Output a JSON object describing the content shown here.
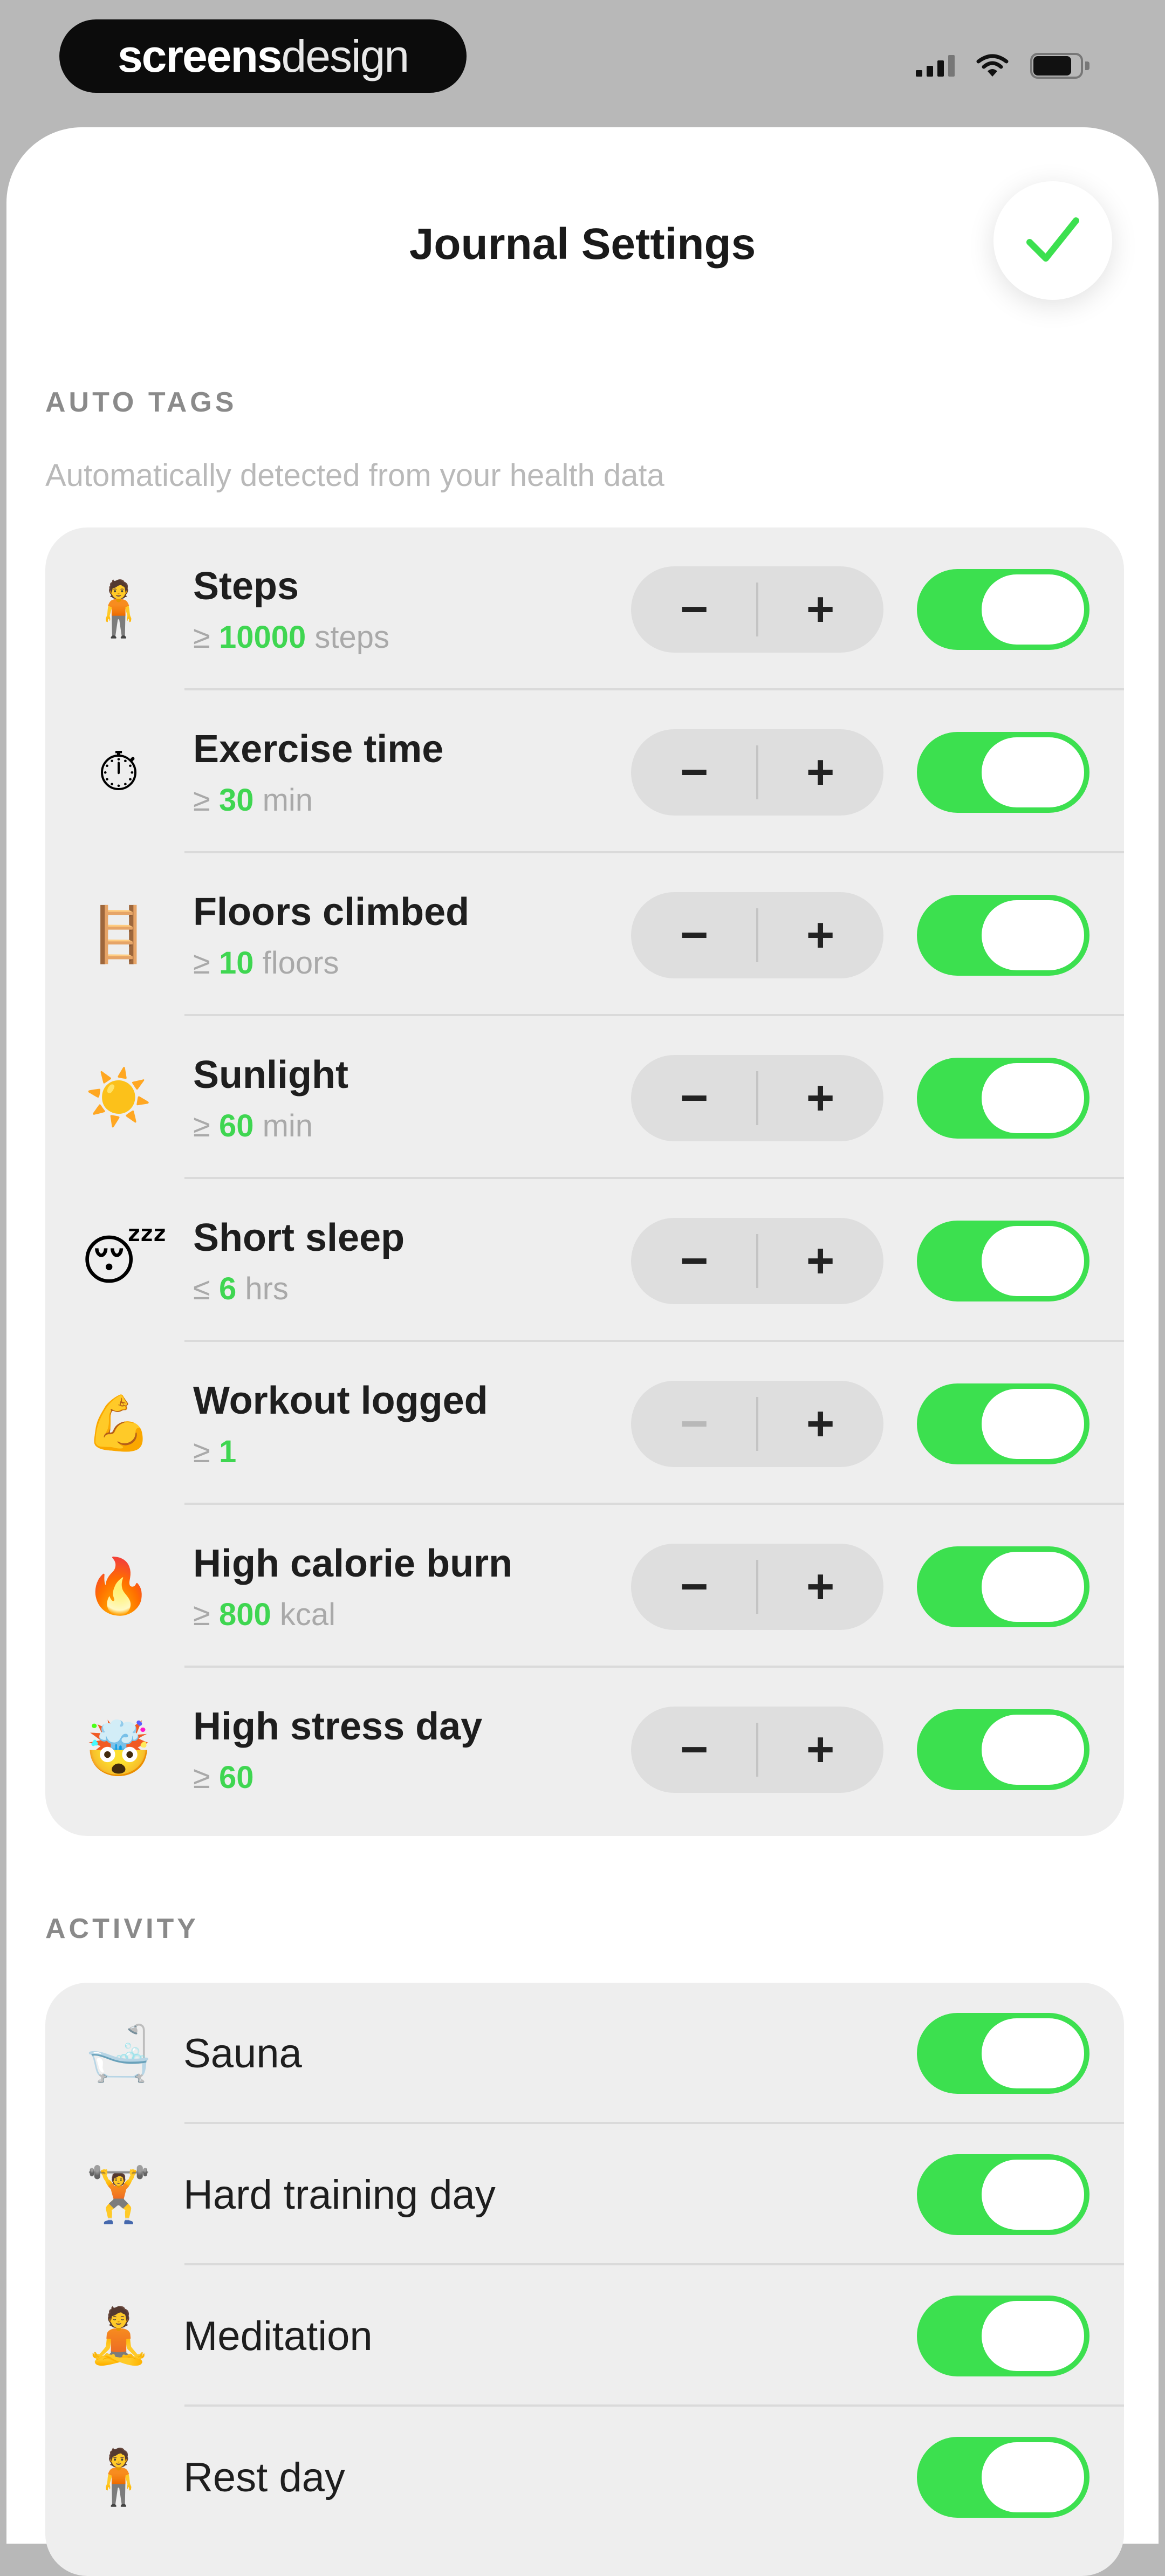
{
  "brand": {
    "bold": "screens",
    "light": "design"
  },
  "header": {
    "title": "Journal Settings"
  },
  "auto_tags": {
    "section_label": "AUTO TAGS",
    "subtitle": "Automatically detected from your health data",
    "minus": "−",
    "plus": "+",
    "items": [
      {
        "icon": "🧍",
        "icon_name": "walking-person-icon",
        "name": "Steps",
        "op": "≥",
        "value": "10000",
        "unit": "steps",
        "enabled": true,
        "minus_disabled": false
      },
      {
        "icon": "⏱",
        "icon_name": "stopwatch-icon",
        "name": "Exercise time",
        "op": "≥",
        "value": "30",
        "unit": "min",
        "enabled": true,
        "minus_disabled": false
      },
      {
        "icon": "🪜",
        "icon_name": "ladder-icon",
        "name": "Floors climbed",
        "op": "≥",
        "value": "10",
        "unit": "floors",
        "enabled": true,
        "minus_disabled": false
      },
      {
        "icon": "☀️",
        "icon_name": "sun-icon",
        "name": "Sunlight",
        "op": "≥",
        "value": "60",
        "unit": "min",
        "enabled": true,
        "minus_disabled": false
      },
      {
        "icon": "😴",
        "icon_name": "sleeping-face-icon",
        "name": "Short sleep",
        "op": "≤",
        "value": "6",
        "unit": "hrs",
        "enabled": true,
        "minus_disabled": false
      },
      {
        "icon": "💪",
        "icon_name": "flexed-biceps-icon",
        "name": "Workout logged",
        "op": "≥",
        "value": "1",
        "unit": "",
        "enabled": true,
        "minus_disabled": true
      },
      {
        "icon": "🔥",
        "icon_name": "fire-icon",
        "name": "High calorie burn",
        "op": "≥",
        "value": "800",
        "unit": "kcal",
        "enabled": true,
        "minus_disabled": false
      },
      {
        "icon": "🤯",
        "icon_name": "exploding-head-icon",
        "name": "High stress day",
        "op": "≥",
        "value": "60",
        "unit": "",
        "enabled": true,
        "minus_disabled": false
      }
    ]
  },
  "activity": {
    "section_label": "ACTIVITY",
    "items": [
      {
        "icon": "🛁",
        "icon_name": "sauna-icon",
        "name": "Sauna",
        "enabled": true
      },
      {
        "icon": "🏋",
        "icon_name": "weightlifter-icon",
        "name": "Hard training day",
        "enabled": true
      },
      {
        "icon": "🧘",
        "icon_name": "meditation-icon",
        "name": "Meditation",
        "enabled": true
      },
      {
        "icon": "🧍",
        "icon_name": "standing-person-icon",
        "name": "Rest day",
        "enabled": true
      }
    ]
  },
  "colors": {
    "accent": "#3ce04f",
    "value_text": "#3fd651",
    "card_bg": "#eeeeee"
  }
}
